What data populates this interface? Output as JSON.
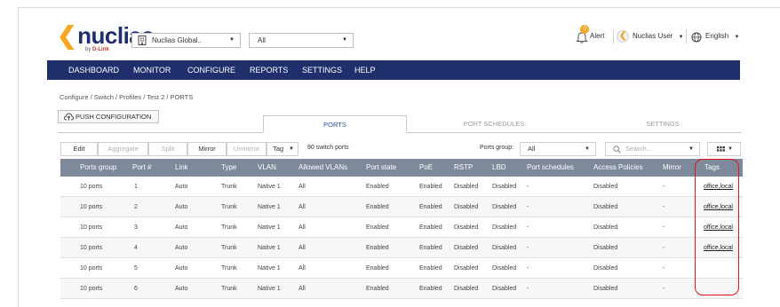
{
  "brand": {
    "name": "nuclias",
    "sub_prefix": "by",
    "sub_brand": "D-Link"
  },
  "header": {
    "org_select": {
      "value": "Nuclias Global.."
    },
    "site_select": {
      "value": "All"
    },
    "alert_badge": "0",
    "alert_label": "Alert",
    "user_label": "Nuclias User",
    "language_label": "English"
  },
  "nav": {
    "items": [
      "DASHBOARD",
      "MONITOR",
      "CONFIGURE",
      "REPORTS",
      "SETTINGS",
      "HELP"
    ]
  },
  "breadcrumb": "Configure / Switch / Profiles / Test 2 / PORTS",
  "push_config_label": "PUSH CONFIGURATION",
  "tabs": [
    "PORTS",
    "PORT SCHEDULES",
    "SETTINGS"
  ],
  "toolbar": {
    "edit": "Edit",
    "aggregate": "Aggregate",
    "split": "Split",
    "mirror": "Mirror",
    "unmirror": "Unmirror",
    "tag": "Tag",
    "port_count": "90 switch ports",
    "ports_group_label": "Ports group:",
    "ports_group_value": "All",
    "search_placeholder": "Search..."
  },
  "table": {
    "headers": [
      "Ports group",
      "Port #",
      "Link",
      "Type",
      "VLAN",
      "Allowed VLANs",
      "Port state",
      "PoE",
      "RSTP",
      "LBD",
      "Port schedules",
      "Access Policies",
      "Mirror",
      "Tags"
    ],
    "rows": [
      [
        "10 ports",
        "1",
        "Auto",
        "Trunk",
        "Native 1",
        "All",
        "Enabled",
        "Enabled",
        "Disabled",
        "Disabled",
        "-",
        "Disabled",
        "-",
        "office,local"
      ],
      [
        "10 ports",
        "2",
        "Auto",
        "Trunk",
        "Native 1",
        "All",
        "Enabled",
        "Enabled",
        "Disabled",
        "Disabled",
        "-",
        "Disabled",
        "-",
        "office,local"
      ],
      [
        "10 ports",
        "3",
        "Auto",
        "Trunk",
        "Native 1",
        "All",
        "Enabled",
        "Enabled",
        "Disabled",
        "Disabled",
        "-",
        "Disabled",
        "-",
        "office,local"
      ],
      [
        "10 ports",
        "4",
        "Auto",
        "Trunk",
        "Native 1",
        "All",
        "Enabled",
        "Enabled",
        "Disabled",
        "Disabled",
        "-",
        "Disabled",
        "-",
        "office,local"
      ],
      [
        "10 ports",
        "5",
        "Auto",
        "Trunk",
        "Native 1",
        "All",
        "Enabled",
        "Enabled",
        "Disabled",
        "Disabled",
        "-",
        "Disabled",
        "-",
        ""
      ],
      [
        "10 ports",
        "6",
        "Auto",
        "Trunk",
        "Native 1",
        "All",
        "Enabled",
        "Enabled",
        "Disabled",
        "Disabled",
        "-",
        "Disabled",
        "-",
        ""
      ]
    ]
  },
  "colors": {
    "nav": "#1e2f6b",
    "table_header": "#7e899b",
    "highlight": "#e0131a",
    "accent": "#f7a823"
  }
}
